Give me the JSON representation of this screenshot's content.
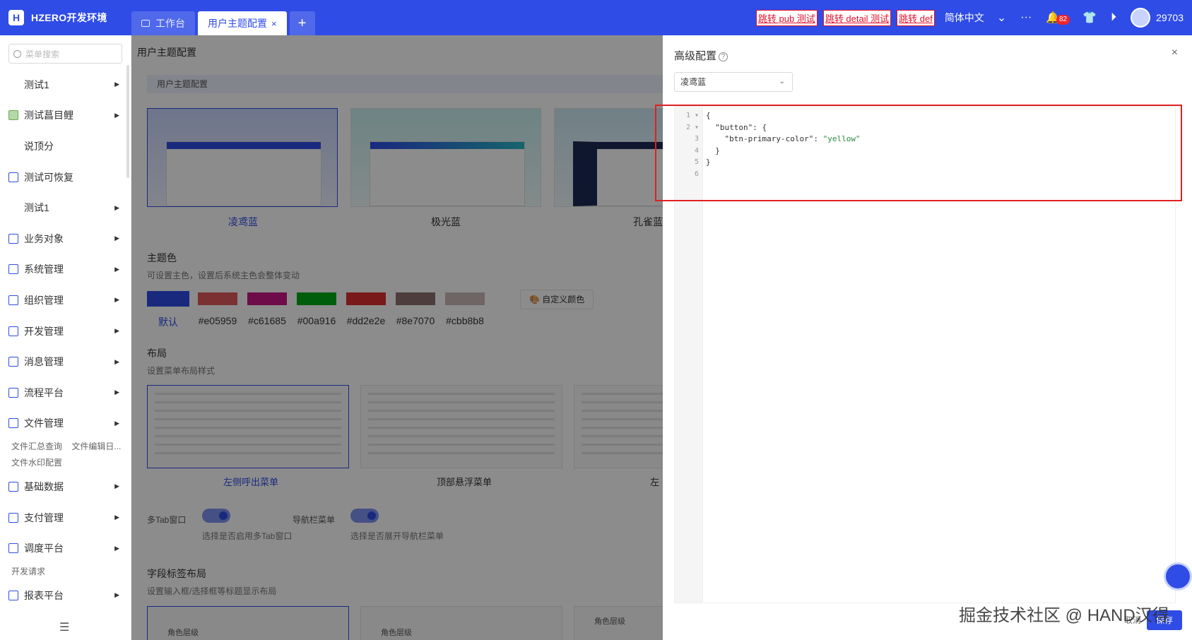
{
  "header": {
    "brand": "HZERO开发环境",
    "tabs": [
      {
        "label": "工作台",
        "active": false
      },
      {
        "label": "用户主题配置",
        "active": true
      }
    ],
    "add_tab": "+",
    "jump_links": [
      "跳转 pub 测试",
      "跳转 detail 测试",
      "跳转 def"
    ],
    "language": "简体中文",
    "more": "···",
    "notification_count": "82",
    "user": "29703"
  },
  "sidebar": {
    "search_placeholder": "菜单搜索",
    "items": [
      {
        "label": "测试1",
        "has_arrow": true,
        "icon": "blank"
      },
      {
        "label": "测试菖目鲤",
        "has_arrow": true,
        "icon": "robot-icon"
      },
      {
        "label": "说顶分",
        "has_arrow": false,
        "icon": "blank"
      },
      {
        "label": "测试可恢复",
        "has_arrow": false,
        "icon": "table-icon"
      },
      {
        "label": "测试1",
        "has_arrow": true,
        "icon": "blank"
      },
      {
        "label": "业务对象",
        "has_arrow": true,
        "icon": "target-icon"
      },
      {
        "label": "系统管理",
        "has_arrow": true,
        "icon": "monitor-icon"
      },
      {
        "label": "组织管理",
        "has_arrow": true,
        "icon": "org-icon"
      },
      {
        "label": "开发管理",
        "has_arrow": true,
        "icon": "code-icon"
      },
      {
        "label": "消息管理",
        "has_arrow": true,
        "icon": "message-icon"
      },
      {
        "label": "流程平台",
        "has_arrow": true,
        "icon": "flow-icon"
      },
      {
        "label": "文件管理",
        "has_arrow": true,
        "icon": "file-icon"
      }
    ],
    "file_sub_links": [
      "文件汇总查询",
      "文件编辑日...",
      "文件水印配置"
    ],
    "items2": [
      {
        "label": "基础数据",
        "has_arrow": true,
        "icon": "data-icon"
      },
      {
        "label": "支付管理",
        "has_arrow": true,
        "icon": "pay-icon"
      },
      {
        "label": "调度平台",
        "has_arrow": true,
        "icon": "schedule-icon"
      }
    ],
    "schedule_sub_links": [
      "开发请求"
    ],
    "items3": [
      {
        "label": "报表平台",
        "has_arrow": true,
        "icon": "report-icon"
      }
    ]
  },
  "main": {
    "title": "用户主题配置",
    "section": "用户主题配置",
    "themes": [
      "凌鸢蓝",
      "极光蓝",
      "孔雀蓝"
    ],
    "theme_color_title": "主题色",
    "theme_color_desc": "可设置主色，设置后系统主色会整体变动",
    "swatches": [
      {
        "label": "默认",
        "color": "#2f4ce6"
      },
      {
        "label": "#e05959",
        "color": "#e05959"
      },
      {
        "label": "#c61685",
        "color": "#c61685"
      },
      {
        "label": "#00a916",
        "color": "#00a916"
      },
      {
        "label": "#dd2e2e",
        "color": "#dd2e2e"
      },
      {
        "label": "#8e7070",
        "color": "#8e7070"
      },
      {
        "label": "#cbb8b8",
        "color": "#cbb8b8"
      }
    ],
    "custom_color": "自定义颜色",
    "layout_title": "布局",
    "layout_desc": "设置菜单布局样式",
    "layouts": [
      "左侧呼出菜单",
      "顶部悬浮菜单",
      "左"
    ],
    "switch1_label": "多Tab窗口",
    "switch1_desc": "选择是否启用多Tab窗口",
    "switch2_label": "导航栏菜单",
    "switch2_desc": "选择是否展开导航栏菜单",
    "field_title": "字段标签布局",
    "field_desc": "设置输入框/选择框等标题显示布局",
    "field_cards": [
      "角色层级",
      "角色层级",
      "角色层级"
    ]
  },
  "drawer": {
    "title": "高级配置",
    "help": "?",
    "close": "×",
    "select_value": "凌鸢蓝",
    "code_lines": [
      {
        "n": "1",
        "fold": true,
        "text": "{"
      },
      {
        "n": "2",
        "fold": true,
        "text": "  \"button\": {"
      },
      {
        "n": "3",
        "fold": false,
        "text": "    \"btn-primary-color\": \"yellow\""
      },
      {
        "n": "4",
        "fold": false,
        "text": "  }"
      },
      {
        "n": "5",
        "fold": false,
        "text": "}"
      },
      {
        "n": "6",
        "fold": false,
        "text": ""
      }
    ],
    "cancel": "取消",
    "save": "保存"
  },
  "credit": "掘金技术社区 @ HAND汉得",
  "colors": {
    "primary": "#2f4ce6",
    "highlight": "#e02020"
  }
}
